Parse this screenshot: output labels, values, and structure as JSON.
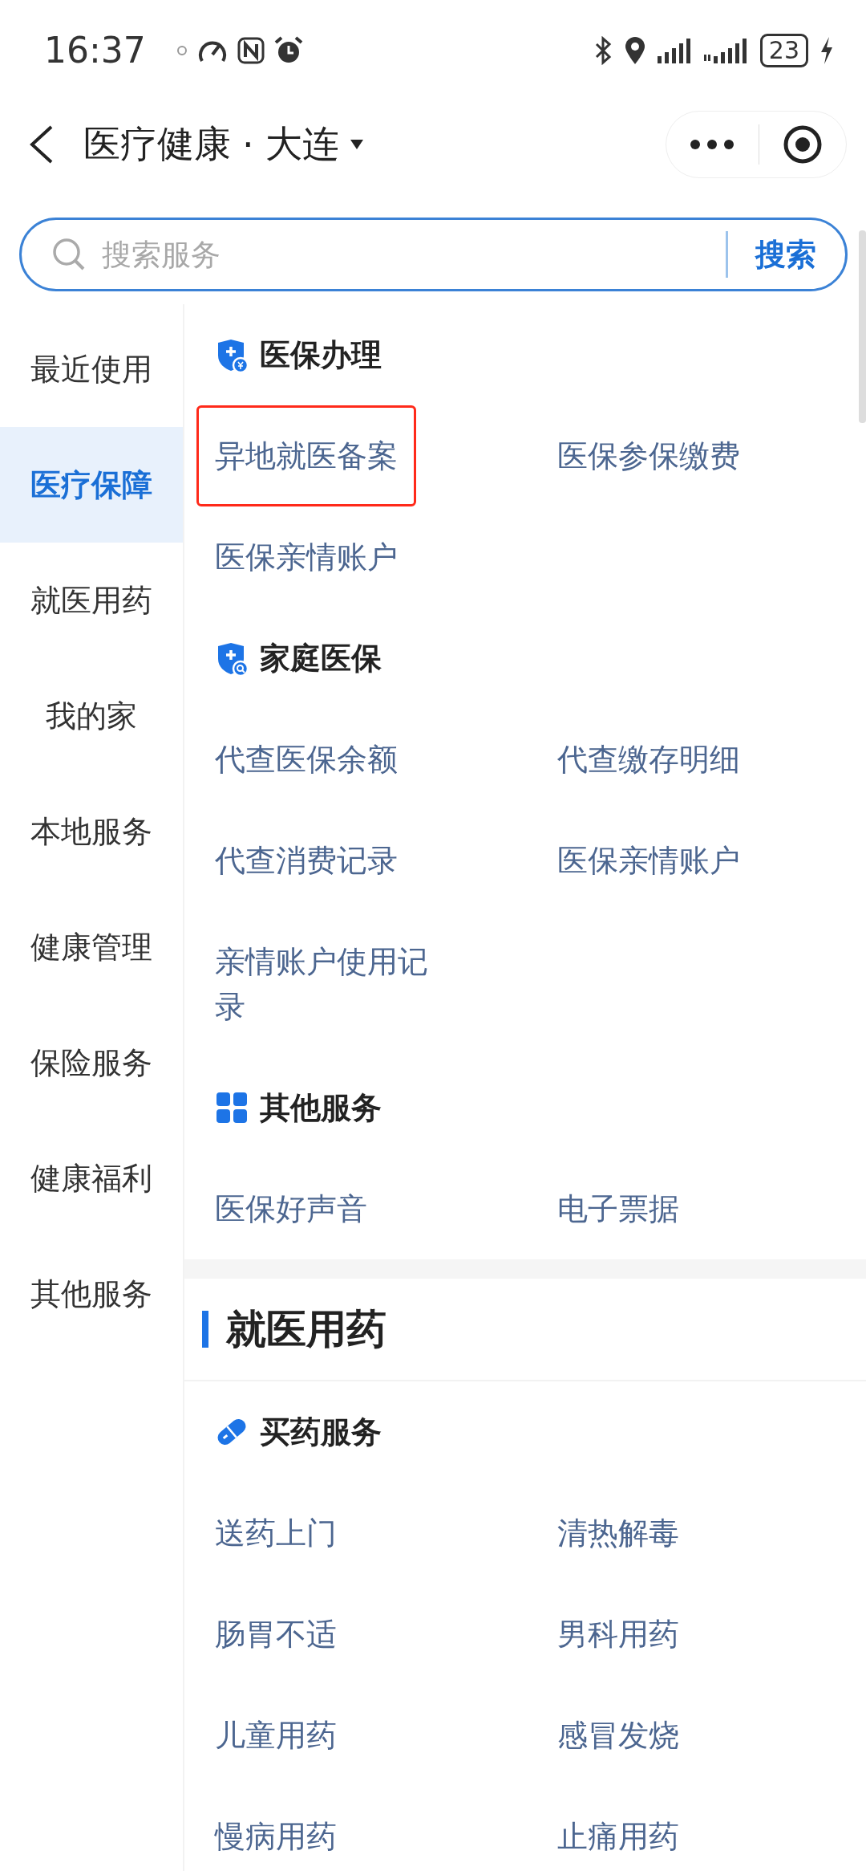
{
  "status_bar": {
    "time": "16:37",
    "battery": "23"
  },
  "header": {
    "title": "医疗健康",
    "separator": "·",
    "city": "大连"
  },
  "search": {
    "placeholder": "搜索服务",
    "button": "搜索"
  },
  "sidebar": {
    "items": [
      {
        "label": "最近使用",
        "selected": false
      },
      {
        "label": "医疗保障",
        "selected": true
      },
      {
        "label": "就医用药",
        "selected": false
      },
      {
        "label": "我的家",
        "selected": false
      },
      {
        "label": "本地服务",
        "selected": false
      },
      {
        "label": "健康管理",
        "selected": false
      },
      {
        "label": "保险服务",
        "selected": false
      },
      {
        "label": "健康福利",
        "selected": false
      },
      {
        "label": "其他服务",
        "selected": false
      }
    ]
  },
  "content": {
    "blocks": [
      {
        "kind": "subheading",
        "title": "医保办理",
        "items": [
          {
            "label": "异地就医备案",
            "highlighted": true
          },
          {
            "label": "医保参保缴费",
            "highlighted": false
          },
          {
            "label": "医保亲情账户",
            "highlighted": false
          }
        ]
      },
      {
        "kind": "subheading",
        "title": "家庭医保",
        "items": [
          {
            "label": "代查医保余额",
            "highlighted": false
          },
          {
            "label": "代查缴存明细",
            "highlighted": false
          },
          {
            "label": "代查消费记录",
            "highlighted": false
          },
          {
            "label": "医保亲情账户",
            "highlighted": false
          },
          {
            "label": "亲情账户使用记录",
            "highlighted": false
          }
        ]
      },
      {
        "kind": "subheading",
        "title": "其他服务",
        "items": [
          {
            "label": "医保好声音",
            "highlighted": false
          },
          {
            "label": "电子票据",
            "highlighted": false
          }
        ]
      },
      {
        "kind": "section",
        "title": "就医用药"
      },
      {
        "kind": "subheading",
        "title": "买药服务",
        "items": [
          {
            "label": "送药上门",
            "highlighted": false
          },
          {
            "label": "清热解毒",
            "highlighted": false
          },
          {
            "label": "肠胃不适",
            "highlighted": false
          },
          {
            "label": "男科用药",
            "highlighted": false
          },
          {
            "label": "儿童用药",
            "highlighted": false
          },
          {
            "label": "感冒发烧",
            "highlighted": false
          },
          {
            "label": "慢病用药",
            "highlighted": false
          },
          {
            "label": "止痛用药",
            "highlighted": false
          }
        ]
      }
    ]
  }
}
